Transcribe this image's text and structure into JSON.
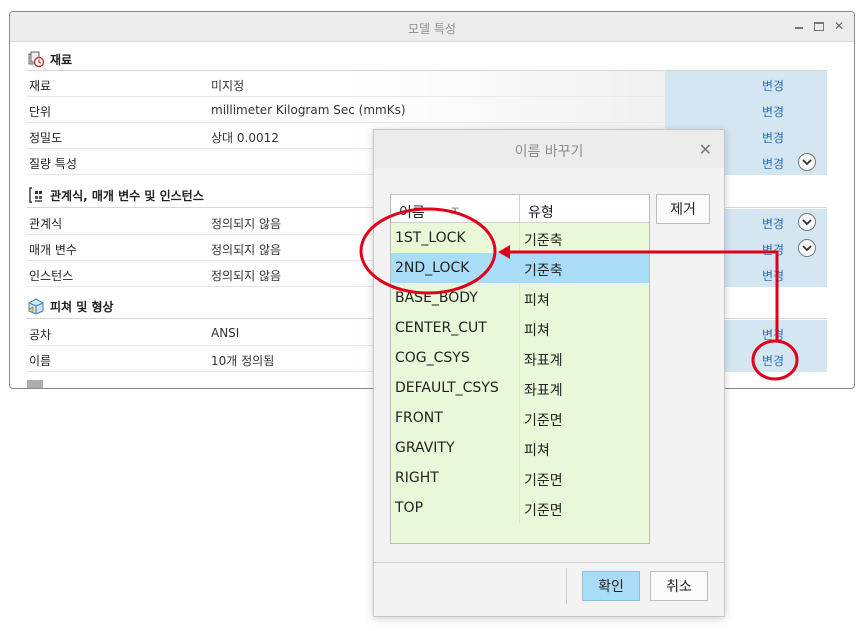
{
  "window": {
    "title": "모델 특성"
  },
  "sections": [
    {
      "title": "재료",
      "icon": "material-icon",
      "rows": [
        {
          "label": "재료",
          "value": "미지정",
          "link": "변경",
          "expand": false
        },
        {
          "label": "단위",
          "value": "millimeter Kilogram Sec (mmKs)",
          "link": "변경",
          "expand": false
        },
        {
          "label": "정밀도",
          "value": "상대 0.0012",
          "link": "변경",
          "expand": false
        },
        {
          "label": "질량 특성",
          "value": "",
          "link": "변경",
          "expand": true
        }
      ]
    },
    {
      "title": "관계식, 매개 변수 및 인스턴스",
      "icon": "relations-icon",
      "rows": [
        {
          "label": "관계식",
          "value": "정의되지 않음",
          "link": "변경",
          "expand": true
        },
        {
          "label": "매개 변수",
          "value": "정의되지 않음",
          "link": "변경",
          "expand": true
        },
        {
          "label": "인스턴스",
          "value": "정의되지 않음",
          "link": "변경",
          "expand": false
        }
      ]
    },
    {
      "title": "피쳐 및 형상",
      "icon": "features-icon",
      "rows": [
        {
          "label": "공차",
          "value": "ANSI",
          "link": "변경",
          "expand": false
        },
        {
          "label": "이름",
          "value": "10개 정의됨",
          "link": "변경",
          "expand": false
        }
      ]
    }
  ],
  "dialog": {
    "title": "이름 바꾸기",
    "columns": {
      "name": "이름",
      "type": "유형"
    },
    "remove_label": "제거",
    "ok_label": "확인",
    "cancel_label": "취소",
    "items": [
      {
        "name": "1ST_LOCK",
        "type": "기준축",
        "selected": false
      },
      {
        "name": "2ND_LOCK",
        "type": "기준축",
        "selected": true
      },
      {
        "name": "BASE_BODY",
        "type": "피쳐",
        "selected": false
      },
      {
        "name": "CENTER_CUT",
        "type": "피쳐",
        "selected": false
      },
      {
        "name": "COG_CSYS",
        "type": "좌표계",
        "selected": false
      },
      {
        "name": "DEFAULT_CSYS",
        "type": "좌표계",
        "selected": false
      },
      {
        "name": "FRONT",
        "type": "기준면",
        "selected": false
      },
      {
        "name": "GRAVITY",
        "type": "피쳐",
        "selected": false
      },
      {
        "name": "RIGHT",
        "type": "기준면",
        "selected": false
      },
      {
        "name": "TOP",
        "type": "기준면",
        "selected": false
      }
    ]
  },
  "colors": {
    "link": "#2a6fb4",
    "link_cell": "#d4e6f1",
    "list_background": "#e8f8d8",
    "selection": "#a9dcf7",
    "annotation": "#e0001b"
  }
}
